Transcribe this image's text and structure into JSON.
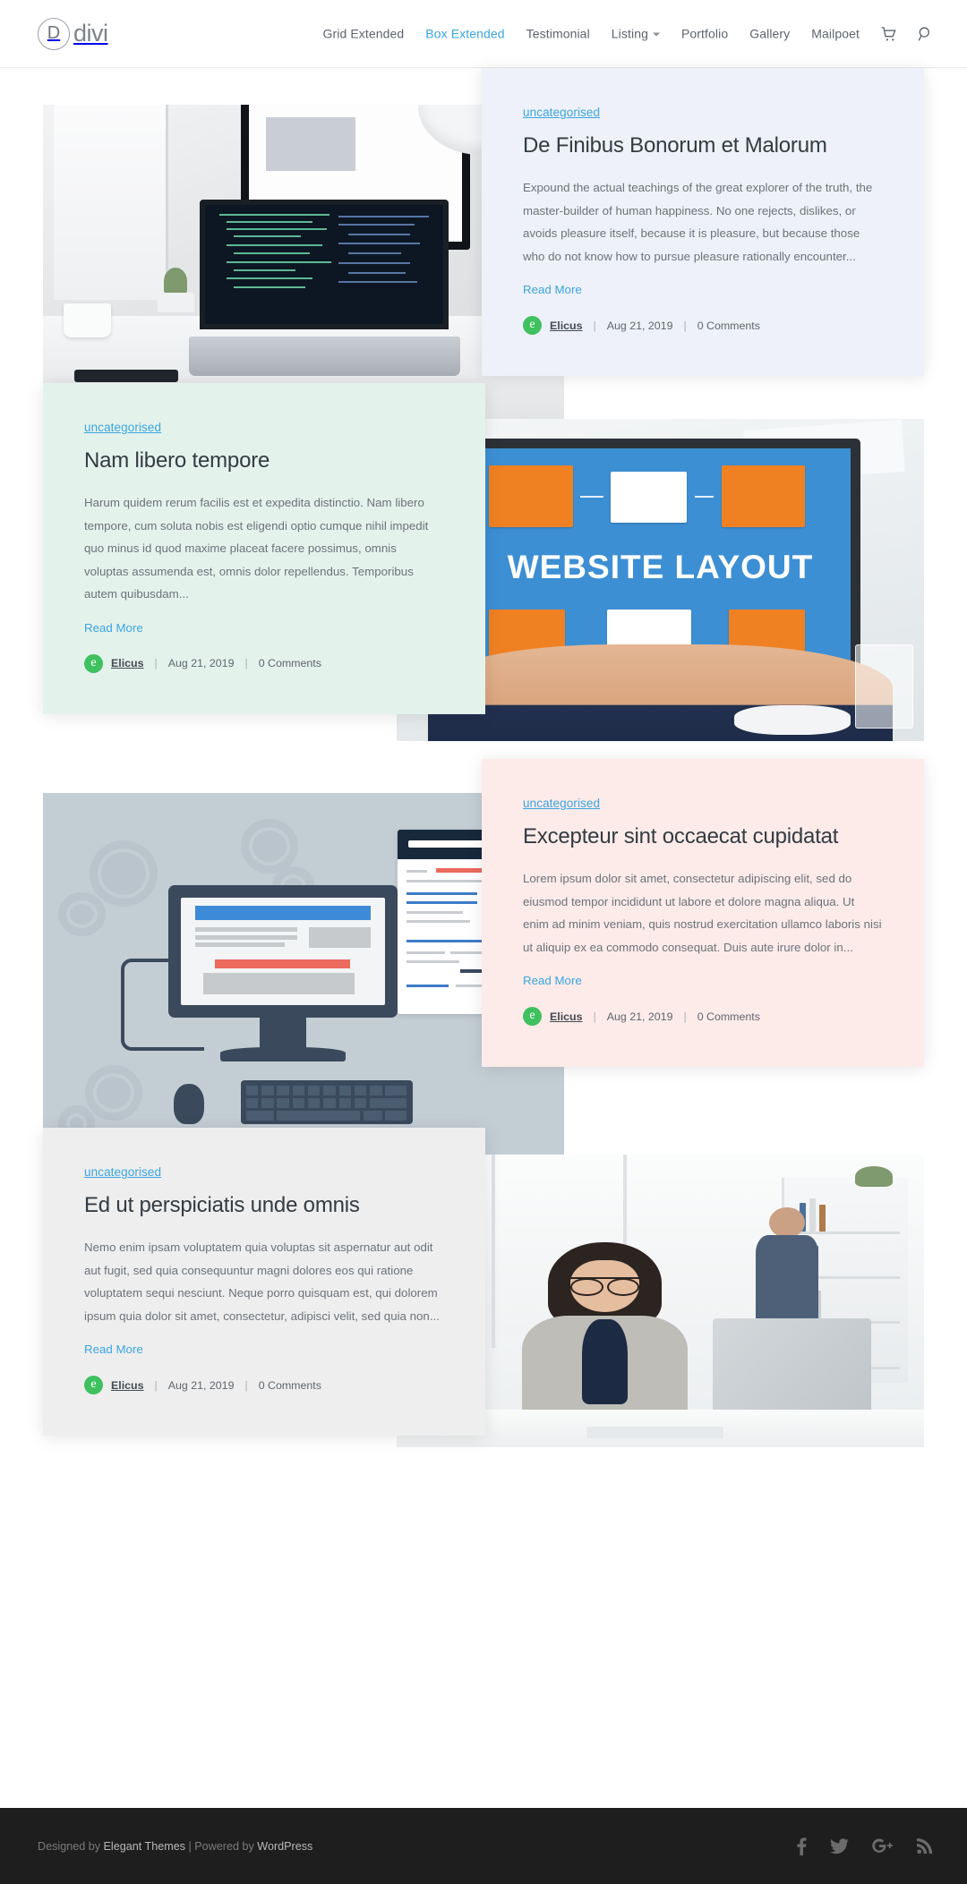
{
  "header": {
    "logo": {
      "mark": "D",
      "text": "divi"
    },
    "nav": [
      {
        "label": "Grid Extended",
        "active": false,
        "has_dropdown": false
      },
      {
        "label": "Box Extended",
        "active": true,
        "has_dropdown": false
      },
      {
        "label": "Testimonial",
        "active": false,
        "has_dropdown": false
      },
      {
        "label": "Listing",
        "active": false,
        "has_dropdown": true
      },
      {
        "label": "Portfolio",
        "active": false,
        "has_dropdown": false
      },
      {
        "label": "Gallery",
        "active": false,
        "has_dropdown": false
      },
      {
        "label": "Mailpoet",
        "active": false,
        "has_dropdown": false
      }
    ],
    "cart_icon": "shopping-cart-icon",
    "search_icon": "search-icon",
    "accent_color": "#3aa5e0"
  },
  "posts": [
    {
      "category": "uncategorised",
      "title": "De Finibus Bonorum et Malorum",
      "excerpt": "Expound the actual teachings of the great explorer of the truth, the master-builder of human happiness. No one rejects, dislikes, or avoids pleasure itself, because it is pleasure, but because those who do not know how to pursue pleasure rationally encounter...",
      "read_more": "Read More",
      "author": "Elicus",
      "date": "Aug 21, 2019",
      "comments": "0 Comments",
      "card_color": "#eef1f9",
      "image_alt": "laptop-with-code-on-desk-photo"
    },
    {
      "category": "uncategorised",
      "title": "Nam libero tempore",
      "excerpt": "Harum quidem rerum facilis est et expedita distinctio. Nam libero tempore, cum soluta nobis est eligendi optio cumque nihil impedit quo minus id quod maxime placeat facere possimus, omnis voluptas assumenda est, omnis dolor repellendus. Temporibus autem quibusdam...",
      "read_more": "Read More",
      "author": "Elicus",
      "date": "Aug 21, 2019",
      "comments": "0 Comments",
      "card_color": "#e4f2ec",
      "image_alt": "website-layout-on-laptop-photo"
    },
    {
      "category": "uncategorised",
      "title": "Excepteur sint occaecat cupidatat",
      "excerpt": "Lorem ipsum dolor sit amet, consectetur adipiscing elit, sed do eiusmod tempor incididunt ut labore et dolore magna aliqua. Ut enim ad minim veniam, quis nostrud exercitation ullamco laboris nisi ut aliquip ex ea commodo consequat. Duis aute irure dolor in...",
      "read_more": "Read More",
      "author": "Elicus",
      "date": "Aug 21, 2019",
      "comments": "0 Comments",
      "card_color": "#fcebe9",
      "image_alt": "desktop-computer-web-design-illustration"
    },
    {
      "category": "uncategorised",
      "title": "Ed ut perspiciatis unde omnis",
      "excerpt": "Nemo enim ipsam voluptatem quia voluptas sit aspernatur aut odit aut fugit, sed quia consequuntur magni dolores eos qui ratione voluptatem sequi nesciunt. Neque porro quisquam est, qui dolorem ipsum quia dolor sit amet, consectetur, adipisci velit, sed quia non...",
      "read_more": "Read More",
      "author": "Elicus",
      "date": "Aug 21, 2019",
      "comments": "0 Comments",
      "card_color": "#eeeeee",
      "image_alt": "woman-working-at-office-computer-photo"
    }
  ],
  "footer": {
    "credit_prefix": "Designed by ",
    "credit_link1": "Elegant Themes",
    "credit_middle": " | Powered by ",
    "credit_link2": "WordPress",
    "social": [
      {
        "name": "facebook-icon"
      },
      {
        "name": "twitter-icon"
      },
      {
        "name": "google-plus-icon"
      },
      {
        "name": "rss-icon"
      }
    ],
    "background": "#1e1e1e"
  }
}
